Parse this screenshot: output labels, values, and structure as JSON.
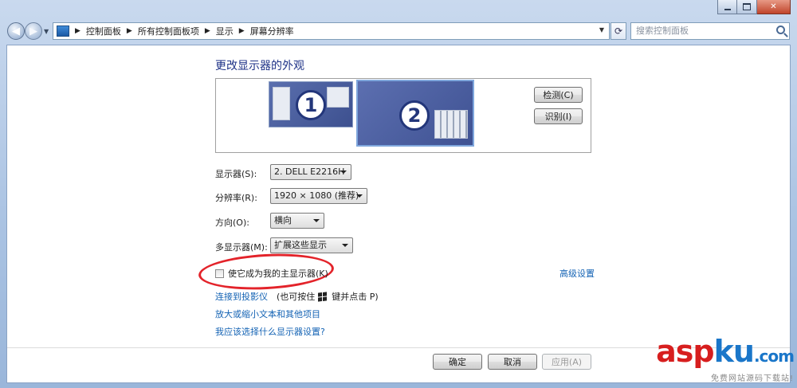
{
  "window": {
    "breadcrumb": [
      "控制面板",
      "所有控制面板项",
      "显示",
      "屏幕分辨率"
    ],
    "search_placeholder": "搜索控制面板"
  },
  "page": {
    "title": "更改显示器的外观",
    "monitors": [
      {
        "number": "1",
        "selected": false
      },
      {
        "number": "2",
        "selected": true
      }
    ],
    "detect_button": "检测(C)",
    "identify_button": "识别(I)",
    "fields": {
      "display": {
        "label": "显示器(S):",
        "value": "2. DELL E2216H"
      },
      "resolution": {
        "label": "分辨率(R):",
        "value": "1920 × 1080 (推荐)"
      },
      "orientation": {
        "label": "方向(O):",
        "value": "横向"
      },
      "multiple_displays": {
        "label": "多显示器(M):",
        "value": "扩展这些显示"
      }
    },
    "main_display_checkbox": {
      "label": "使它成为我的主显示器(K)",
      "checked": false
    },
    "advanced_link": "高级设置",
    "projector_link": "连接到投影仪",
    "projector_hint_prefix": "(也可按住",
    "projector_hint_suffix": "键并点击 P)",
    "zoom_link": "放大或缩小文本和其他项目",
    "which_settings_link": "我应该选择什么显示器设置?",
    "ok_button": "确定",
    "cancel_button": "取消",
    "apply_button": "应用(A)"
  },
  "watermark": {
    "main_a": "asp",
    "main_k": "ku",
    "main_com": ".com",
    "sub": "免费网站源码下载站!"
  },
  "colors": {
    "link": "#1463b4",
    "title": "#1e3287",
    "annotation": "#e3232a"
  }
}
